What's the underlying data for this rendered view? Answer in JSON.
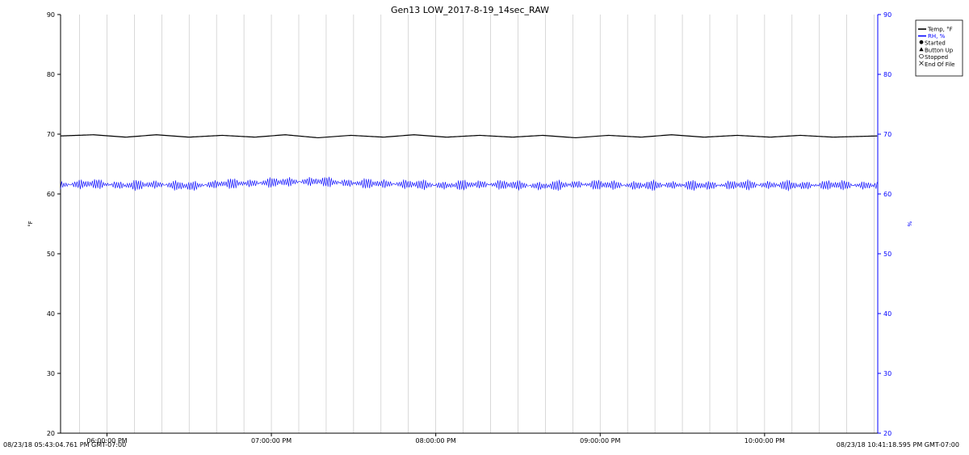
{
  "chart_data": {
    "type": "line",
    "title": "Gen13 LOW_2017-8-19_14sec_RAW",
    "ylabel_left": "°F",
    "ylabel_right": "%",
    "ylim_left": [
      20,
      90
    ],
    "ylim_right": [
      20,
      90
    ],
    "yticks_left": [
      "20",
      "30",
      "40",
      "50",
      "60",
      "70",
      "80",
      "90"
    ],
    "yticks_right": [
      "20",
      "30",
      "40",
      "50",
      "60",
      "70",
      "80",
      "90"
    ],
    "x_ticks": [
      "06:00:00 PM",
      "07:00:00 PM",
      "08:00:00 PM",
      "09:00:00 PM",
      "10:00:00 PM"
    ],
    "x_start_label": "08/23/18 05:43:04.761 PM GMT-07:00",
    "x_end_label": "08/23/18 10:41:18.595 PM GMT-07:00",
    "x_start": "05:43:04 PM",
    "x_end": "10:41:18 PM",
    "grid": "vertical",
    "legend_position": "top-right",
    "legend": [
      {
        "label": "Temp, °F",
        "symbol": "line",
        "color": "#000000"
      },
      {
        "label": "RH, %",
        "symbol": "line",
        "color": "#0000ff"
      },
      {
        "label": "Started",
        "symbol": "filled-circle",
        "color": "#000000"
      },
      {
        "label": "Button Up",
        "symbol": "triangle",
        "color": "#000000"
      },
      {
        "label": "Stopped",
        "symbol": "open-circle",
        "color": "#000000"
      },
      {
        "label": "End Of File",
        "symbol": "x-mark",
        "color": "#000000"
      }
    ],
    "series": [
      {
        "name": "Temp, °F",
        "axis": "left",
        "color": "#000000",
        "x": [
          "05:43 PM",
          "05:55 PM",
          "06:07 PM",
          "06:18 PM",
          "06:30 PM",
          "06:42 PM",
          "06:54 PM",
          "07:05 PM",
          "07:17 PM",
          "07:29 PM",
          "07:41 PM",
          "07:52 PM",
          "08:04 PM",
          "08:16 PM",
          "08:28 PM",
          "08:39 PM",
          "08:51 PM",
          "09:03 PM",
          "09:15 PM",
          "09:26 PM",
          "09:38 PM",
          "09:50 PM",
          "10:02 PM",
          "10:13 PM",
          "10:25 PM",
          "10:41 PM"
        ],
        "values": [
          69.7,
          69.9,
          69.5,
          69.9,
          69.5,
          69.8,
          69.5,
          69.9,
          69.4,
          69.8,
          69.5,
          69.9,
          69.5,
          69.8,
          69.5,
          69.8,
          69.4,
          69.8,
          69.5,
          69.9,
          69.5,
          69.8,
          69.5,
          69.8,
          69.5,
          69.7
        ]
      },
      {
        "name": "RH, %",
        "axis": "right",
        "color": "#0000ff",
        "x": [
          "05:43 PM",
          "05:55 PM",
          "06:07 PM",
          "06:18 PM",
          "06:30 PM",
          "06:42 PM",
          "06:54 PM",
          "07:05 PM",
          "07:17 PM",
          "07:29 PM",
          "07:41 PM",
          "07:52 PM",
          "08:04 PM",
          "08:16 PM",
          "08:28 PM",
          "08:39 PM",
          "08:51 PM",
          "09:03 PM",
          "09:15 PM",
          "09:26 PM",
          "09:38 PM",
          "09:50 PM",
          "10:02 PM",
          "10:13 PM",
          "10:25 PM",
          "10:41 PM"
        ],
        "values": [
          61.5,
          61.7,
          61.4,
          61.6,
          61.3,
          61.7,
          61.8,
          62.0,
          62.1,
          61.8,
          61.7,
          61.6,
          61.4,
          61.6,
          61.5,
          61.3,
          61.6,
          61.5,
          61.4,
          61.5,
          61.4,
          61.5,
          61.5,
          61.4,
          61.5,
          61.4
        ],
        "fluctuation_range": [
          60.0,
          63.0
        ]
      }
    ]
  }
}
